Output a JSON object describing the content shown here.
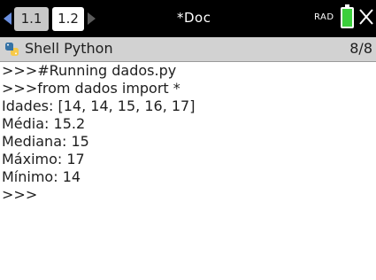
{
  "topbar": {
    "tabs": [
      {
        "label": "1.1",
        "active": false
      },
      {
        "label": "1.2",
        "active": true
      }
    ],
    "doc_title": "*Doc",
    "mode": "RAD",
    "battery_level": 1.0,
    "colors": {
      "background": "#000000",
      "nav_arrow_active": "#6a8fe0",
      "battery_fill": "#3ccf3c"
    },
    "icons": [
      "nav-left-arrow-icon",
      "nav-right-arrow-icon",
      "battery-icon",
      "close-icon"
    ]
  },
  "shell": {
    "icon": "python-icon",
    "title": "Shell Python",
    "page_indicator": "8/8"
  },
  "console": {
    "lines": [
      ">>>#Running dados.py",
      ">>>from dados import *",
      "Idades: [14, 14, 15, 16, 17]",
      "Média: 15.2",
      "Mediana: 15",
      "Máximo: 17",
      "Mínimo: 14",
      ">>>"
    ]
  }
}
